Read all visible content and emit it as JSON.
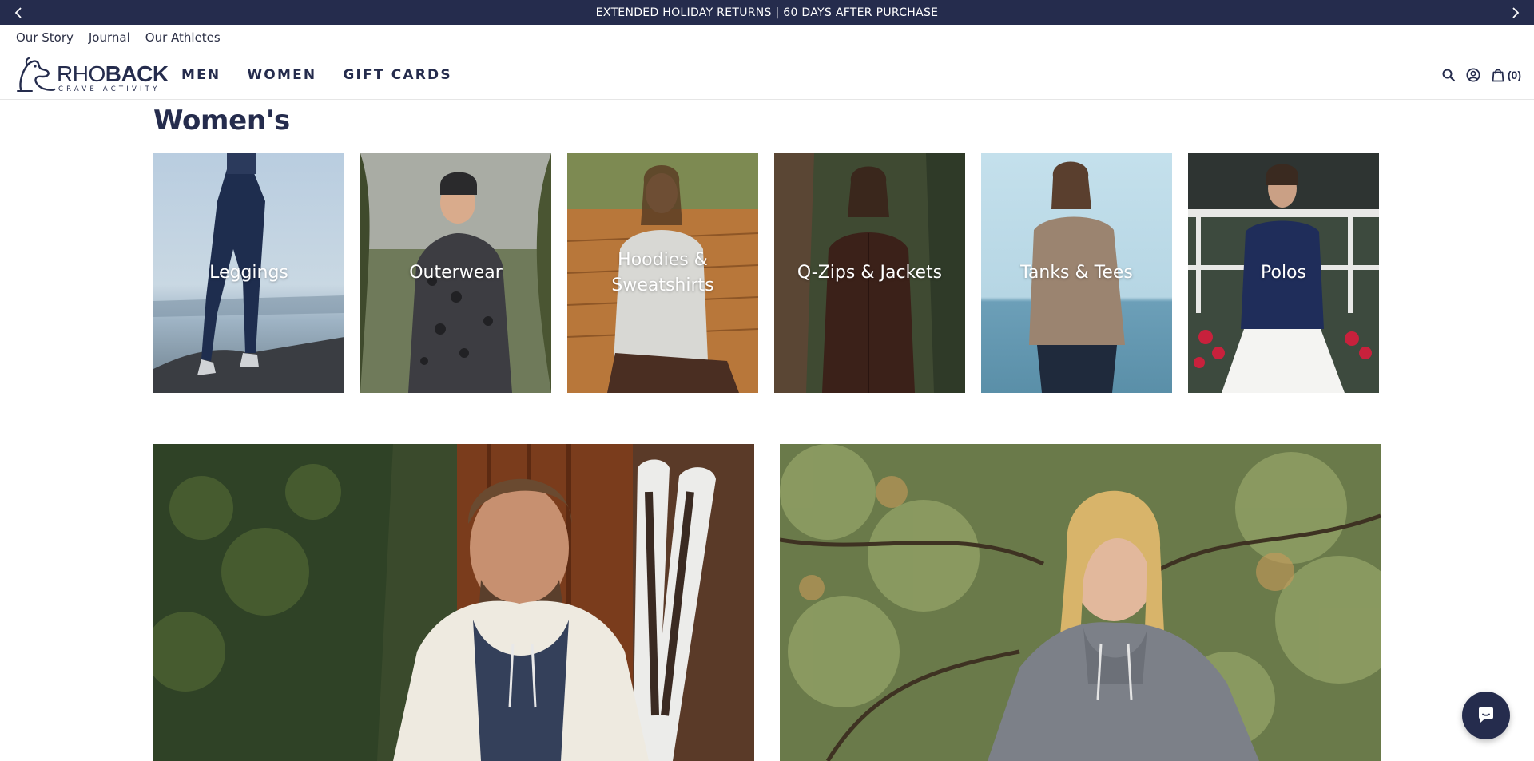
{
  "announcement": {
    "text": "EXTENDED HOLIDAY RETURNS | 60 DAYS AFTER PURCHASE",
    "prev_icon": "chevron-left-icon",
    "next_icon": "chevron-right-icon"
  },
  "utility_nav": [
    "Our Story",
    "Journal",
    "Our Athletes"
  ],
  "logo": {
    "word_thin": "RHO",
    "word_bold": "BACK",
    "tagline": "CRAVE ACTIVITY"
  },
  "main_nav": [
    "MEN",
    "WOMEN",
    "GIFT CARDS"
  ],
  "header_icons": {
    "search": "search-icon",
    "account": "account-icon",
    "cart": "shopping-bag-icon",
    "cart_count": "(0)"
  },
  "page_title": "Women's",
  "categories": [
    {
      "label": "Leggings"
    },
    {
      "label": "Outerwear"
    },
    {
      "label": "Hoodies & Sweatshirts"
    },
    {
      "label": "Q-Zips & Jackets"
    },
    {
      "label": "Tanks & Tees"
    },
    {
      "label": "Polos"
    }
  ],
  "colors": {
    "brand_navy": "#252c4d",
    "text": "#2b2f45",
    "divider": "#e6e6e6"
  },
  "chat": {
    "icon": "chat-bubble-icon"
  }
}
